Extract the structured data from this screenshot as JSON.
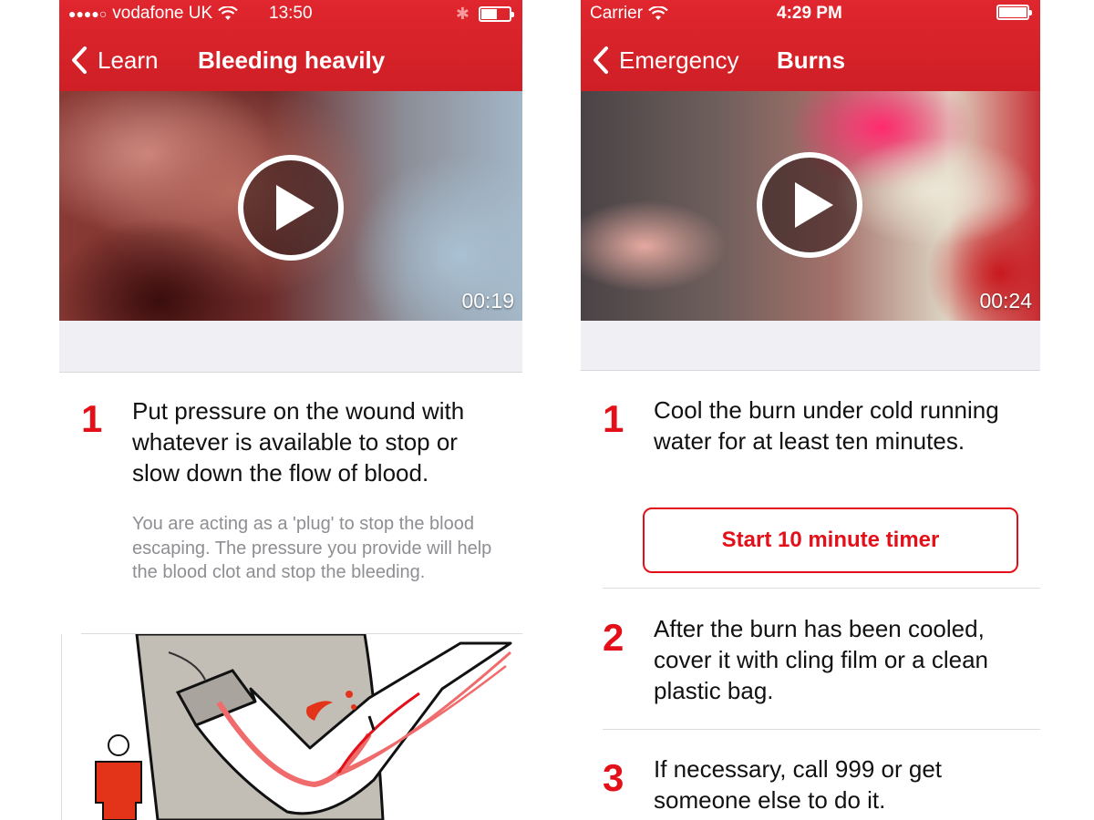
{
  "colors": {
    "brand_red": "#d9232a",
    "step_number_red": "#e3101a",
    "secondary_text": "#8e8e93",
    "band_grey": "#efeff4"
  },
  "left_screen": {
    "status_bar": {
      "signal": "●●●●○",
      "carrier": "vodafone UK",
      "wifi_icon": "wifi-icon",
      "time": "13:50",
      "bluetooth_icon": "bluetooth-icon",
      "battery_level": 0.55
    },
    "nav": {
      "back_label": "Learn",
      "title": "Bleeding heavily"
    },
    "video": {
      "duration": "00:19",
      "play_icon": "play-icon"
    },
    "steps": [
      {
        "number": "1",
        "text": "Put pressure on the wound with whatever is available to stop or slow down the flow of blood.",
        "detail": "You are acting as a 'plug' to stop the blood escaping. The pressure you provide will help the blood clot and stop the bleeding."
      }
    ],
    "illustration": "bleeding-arm-illustration"
  },
  "right_screen": {
    "status_bar": {
      "carrier": "Carrier",
      "wifi_icon": "wifi-icon",
      "time": "4:29 PM",
      "battery_level": 1.0
    },
    "nav": {
      "back_label": "Emergency",
      "title": "Burns"
    },
    "video": {
      "duration": "00:24",
      "play_icon": "play-icon"
    },
    "steps": [
      {
        "number": "1",
        "text": "Cool the burn under cold running water for at least ten minutes."
      },
      {
        "number": "2",
        "text": "After the burn has been cooled, cover it with cling film or a clean plastic bag."
      },
      {
        "number": "3",
        "text": "If necessary, call 999 or get someone else to do it."
      }
    ],
    "timer_button_label": "Start 10 minute timer"
  }
}
